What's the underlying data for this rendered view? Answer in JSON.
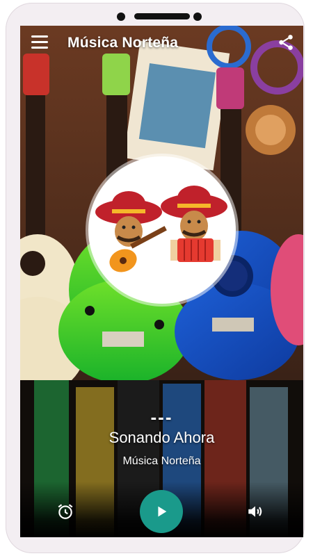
{
  "app": {
    "title": "Música Norteña"
  },
  "player": {
    "track_placeholder": "---",
    "now_playing_label": "Sonando Ahora",
    "station_name": "Música Norteña"
  },
  "icons": {
    "menu": "menu-icon",
    "share": "share-icon",
    "alarm": "alarm-icon",
    "play": "play-icon",
    "volume": "volume-icon"
  },
  "colors": {
    "play_button": "#1a9a8b",
    "sombrero": "#c0212b",
    "hat_band": "#f5b72a"
  }
}
